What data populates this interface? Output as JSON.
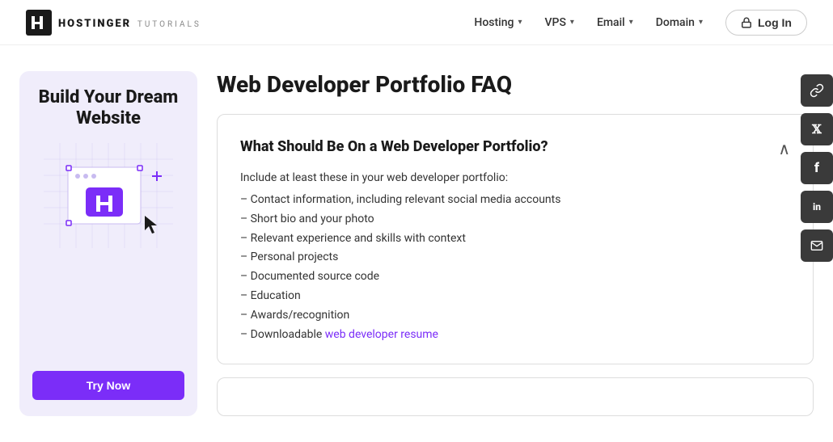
{
  "header": {
    "logo_main": "HOSTINGER",
    "logo_sub": "TUTORIALS",
    "nav_items": [
      {
        "label": "Hosting",
        "has_dropdown": true
      },
      {
        "label": "VPS",
        "has_dropdown": true
      },
      {
        "label": "Email",
        "has_dropdown": true
      },
      {
        "label": "Domain",
        "has_dropdown": true
      }
    ],
    "login_label": "Log In"
  },
  "sidebar_ad": {
    "title": "Build Your Dream Website",
    "cta_label": "Try Now"
  },
  "main": {
    "page_title": "Web Developer Portfolio FAQ",
    "faq_items": [
      {
        "question": "What Should Be On a Web Developer Portfolio?",
        "intro": "Include at least these in your web developer portfolio:",
        "list_items": [
          "– Contact information, including relevant social media accounts",
          "– Short bio and your photo",
          "– Relevant experience and skills with context",
          "– Personal projects",
          "– Documented source code",
          "– Education",
          "– Awards/recognition"
        ],
        "link_text": "web developer resume",
        "link_prefix": "– Downloadable ",
        "expanded": true
      }
    ]
  },
  "social": {
    "buttons": [
      {
        "icon": "link",
        "label": "copy-link"
      },
      {
        "icon": "X",
        "label": "x-twitter"
      },
      {
        "icon": "f",
        "label": "facebook"
      },
      {
        "icon": "in",
        "label": "linkedin"
      },
      {
        "icon": "✉",
        "label": "email"
      }
    ]
  }
}
